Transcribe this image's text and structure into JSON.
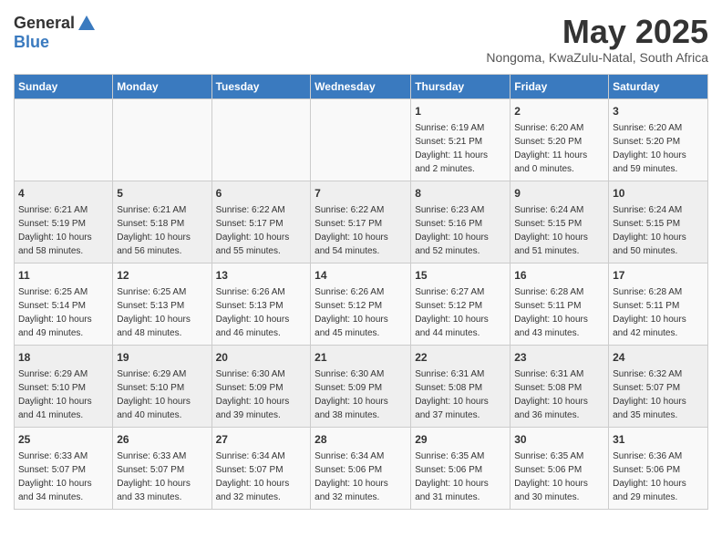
{
  "header": {
    "logo_general": "General",
    "logo_blue": "Blue",
    "month_title": "May 2025",
    "subtitle": "Nongoma, KwaZulu-Natal, South Africa"
  },
  "weekdays": [
    "Sunday",
    "Monday",
    "Tuesday",
    "Wednesday",
    "Thursday",
    "Friday",
    "Saturday"
  ],
  "weeks": [
    [
      {
        "day": "",
        "info": ""
      },
      {
        "day": "",
        "info": ""
      },
      {
        "day": "",
        "info": ""
      },
      {
        "day": "",
        "info": ""
      },
      {
        "day": "1",
        "info": "Sunrise: 6:19 AM\nSunset: 5:21 PM\nDaylight: 11 hours\nand 2 minutes."
      },
      {
        "day": "2",
        "info": "Sunrise: 6:20 AM\nSunset: 5:20 PM\nDaylight: 11 hours\nand 0 minutes."
      },
      {
        "day": "3",
        "info": "Sunrise: 6:20 AM\nSunset: 5:20 PM\nDaylight: 10 hours\nand 59 minutes."
      }
    ],
    [
      {
        "day": "4",
        "info": "Sunrise: 6:21 AM\nSunset: 5:19 PM\nDaylight: 10 hours\nand 58 minutes."
      },
      {
        "day": "5",
        "info": "Sunrise: 6:21 AM\nSunset: 5:18 PM\nDaylight: 10 hours\nand 56 minutes."
      },
      {
        "day": "6",
        "info": "Sunrise: 6:22 AM\nSunset: 5:17 PM\nDaylight: 10 hours\nand 55 minutes."
      },
      {
        "day": "7",
        "info": "Sunrise: 6:22 AM\nSunset: 5:17 PM\nDaylight: 10 hours\nand 54 minutes."
      },
      {
        "day": "8",
        "info": "Sunrise: 6:23 AM\nSunset: 5:16 PM\nDaylight: 10 hours\nand 52 minutes."
      },
      {
        "day": "9",
        "info": "Sunrise: 6:24 AM\nSunset: 5:15 PM\nDaylight: 10 hours\nand 51 minutes."
      },
      {
        "day": "10",
        "info": "Sunrise: 6:24 AM\nSunset: 5:15 PM\nDaylight: 10 hours\nand 50 minutes."
      }
    ],
    [
      {
        "day": "11",
        "info": "Sunrise: 6:25 AM\nSunset: 5:14 PM\nDaylight: 10 hours\nand 49 minutes."
      },
      {
        "day": "12",
        "info": "Sunrise: 6:25 AM\nSunset: 5:13 PM\nDaylight: 10 hours\nand 48 minutes."
      },
      {
        "day": "13",
        "info": "Sunrise: 6:26 AM\nSunset: 5:13 PM\nDaylight: 10 hours\nand 46 minutes."
      },
      {
        "day": "14",
        "info": "Sunrise: 6:26 AM\nSunset: 5:12 PM\nDaylight: 10 hours\nand 45 minutes."
      },
      {
        "day": "15",
        "info": "Sunrise: 6:27 AM\nSunset: 5:12 PM\nDaylight: 10 hours\nand 44 minutes."
      },
      {
        "day": "16",
        "info": "Sunrise: 6:28 AM\nSunset: 5:11 PM\nDaylight: 10 hours\nand 43 minutes."
      },
      {
        "day": "17",
        "info": "Sunrise: 6:28 AM\nSunset: 5:11 PM\nDaylight: 10 hours\nand 42 minutes."
      }
    ],
    [
      {
        "day": "18",
        "info": "Sunrise: 6:29 AM\nSunset: 5:10 PM\nDaylight: 10 hours\nand 41 minutes."
      },
      {
        "day": "19",
        "info": "Sunrise: 6:29 AM\nSunset: 5:10 PM\nDaylight: 10 hours\nand 40 minutes."
      },
      {
        "day": "20",
        "info": "Sunrise: 6:30 AM\nSunset: 5:09 PM\nDaylight: 10 hours\nand 39 minutes."
      },
      {
        "day": "21",
        "info": "Sunrise: 6:30 AM\nSunset: 5:09 PM\nDaylight: 10 hours\nand 38 minutes."
      },
      {
        "day": "22",
        "info": "Sunrise: 6:31 AM\nSunset: 5:08 PM\nDaylight: 10 hours\nand 37 minutes."
      },
      {
        "day": "23",
        "info": "Sunrise: 6:31 AM\nSunset: 5:08 PM\nDaylight: 10 hours\nand 36 minutes."
      },
      {
        "day": "24",
        "info": "Sunrise: 6:32 AM\nSunset: 5:07 PM\nDaylight: 10 hours\nand 35 minutes."
      }
    ],
    [
      {
        "day": "25",
        "info": "Sunrise: 6:33 AM\nSunset: 5:07 PM\nDaylight: 10 hours\nand 34 minutes."
      },
      {
        "day": "26",
        "info": "Sunrise: 6:33 AM\nSunset: 5:07 PM\nDaylight: 10 hours\nand 33 minutes."
      },
      {
        "day": "27",
        "info": "Sunrise: 6:34 AM\nSunset: 5:07 PM\nDaylight: 10 hours\nand 32 minutes."
      },
      {
        "day": "28",
        "info": "Sunrise: 6:34 AM\nSunset: 5:06 PM\nDaylight: 10 hours\nand 32 minutes."
      },
      {
        "day": "29",
        "info": "Sunrise: 6:35 AM\nSunset: 5:06 PM\nDaylight: 10 hours\nand 31 minutes."
      },
      {
        "day": "30",
        "info": "Sunrise: 6:35 AM\nSunset: 5:06 PM\nDaylight: 10 hours\nand 30 minutes."
      },
      {
        "day": "31",
        "info": "Sunrise: 6:36 AM\nSunset: 5:06 PM\nDaylight: 10 hours\nand 29 minutes."
      }
    ]
  ]
}
